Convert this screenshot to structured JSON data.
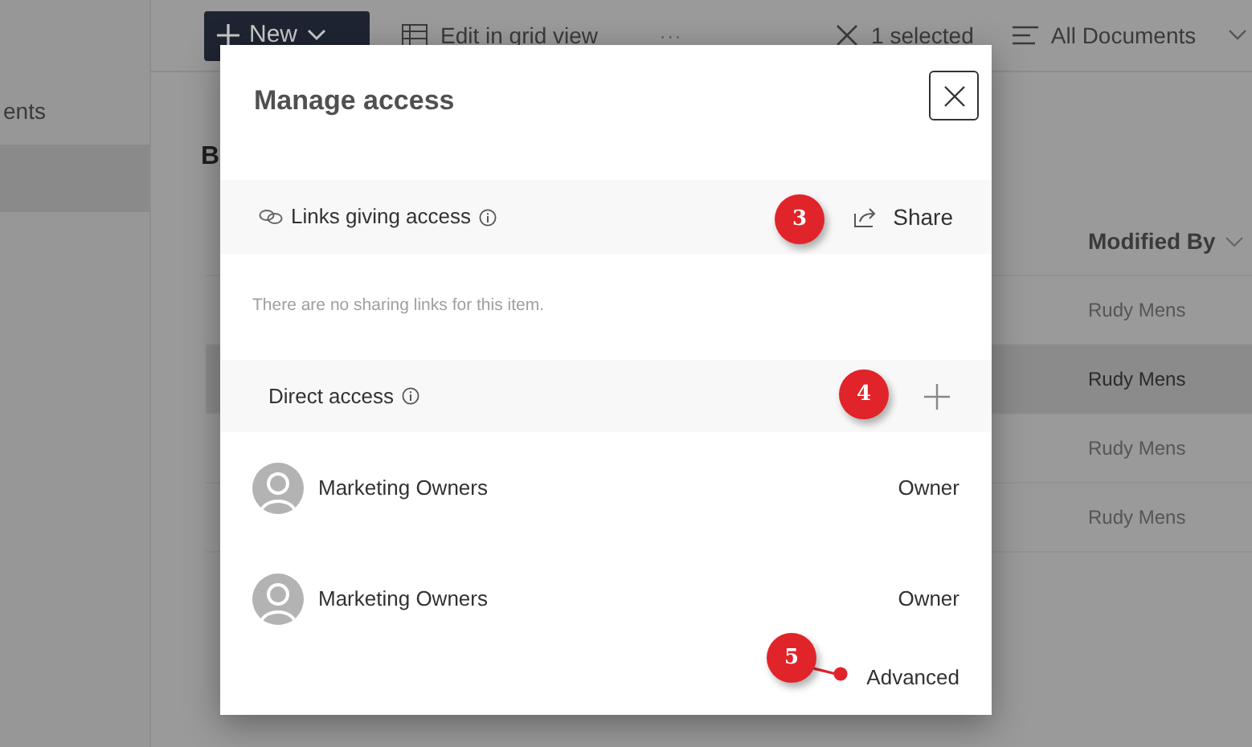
{
  "nav": {
    "items": [
      {
        "label": "ents",
        "selected": false
      },
      {
        "selected": true
      }
    ]
  },
  "toolbar": {
    "new_button": "New",
    "edit_grid": "Edit in grid view",
    "more": "···",
    "selection": "1 selected",
    "view": "All Documents"
  },
  "heading": "B",
  "table": {
    "columns": [
      "Modified By"
    ],
    "rows": [
      {
        "modified_by": "Rudy Mens",
        "selected": false
      },
      {
        "modified_by": "Rudy Mens",
        "selected": true
      },
      {
        "modified_by": "Rudy Mens",
        "selected": false
      },
      {
        "modified_by": "Rudy Mens",
        "selected": false
      }
    ]
  },
  "dialog": {
    "title": "Manage access",
    "links": {
      "title": "Links giving access",
      "share": "Share",
      "empty": "There are no sharing links for this item."
    },
    "direct": {
      "title": "Direct access",
      "members": [
        {
          "name": "Marketing Owners",
          "role": "Owner"
        },
        {
          "name": "Marketing Owners",
          "role": "Owner"
        }
      ],
      "advanced": "Advanced"
    }
  },
  "annotations": [
    {
      "number": "3",
      "leader": false
    },
    {
      "number": "4",
      "leader": false
    },
    {
      "number": "5",
      "leader": true
    }
  ]
}
